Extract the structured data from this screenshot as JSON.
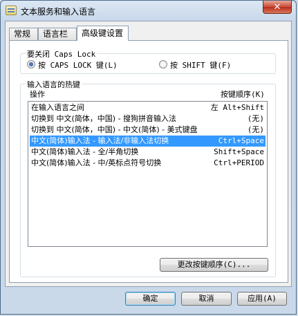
{
  "window": {
    "title": "文本服务和输入语言",
    "close_glyph": "✕"
  },
  "tabs": [
    {
      "label": "常规"
    },
    {
      "label": "语言栏"
    },
    {
      "label": "高级键设置",
      "active": true
    }
  ],
  "caps_lock": {
    "group_label": "要关闭 Caps Lock",
    "options": [
      {
        "label": "按 CAPS LOCK 键(L)",
        "checked": true
      },
      {
        "label": "按 SHIFT 键(F)",
        "checked": false
      }
    ]
  },
  "hotkeys": {
    "group_label": "输入语言的热键",
    "col_action": "操作",
    "col_key": "按键顺序(K)",
    "rows": [
      {
        "action": "在输入语言之间",
        "key": "左 Alt+Shift",
        "selected": false
      },
      {
        "action": "切换到 中文(简体，中国) - 搜狗拼音输入法",
        "key": "(无)",
        "selected": false
      },
      {
        "action": "切换到 中文(简体，中国) - 中文(简体) - 美式键盘",
        "key": "(无)",
        "selected": false
      },
      {
        "action": "中文(简体)输入法 - 输入法/非输入法切换",
        "key": "Ctrl+Space",
        "selected": true
      },
      {
        "action": "中文(简体)输入法 - 全/半角切换",
        "key": "Shift+Space",
        "selected": false
      },
      {
        "action": "中文(简体)输入法 - 中/英标点符号切换",
        "key": "Ctrl+PERIOD",
        "selected": false
      }
    ],
    "change_button": "更改按键顺序(C)..."
  },
  "footer": {
    "ok": "确定",
    "cancel": "取消",
    "apply": "应用(A)"
  }
}
